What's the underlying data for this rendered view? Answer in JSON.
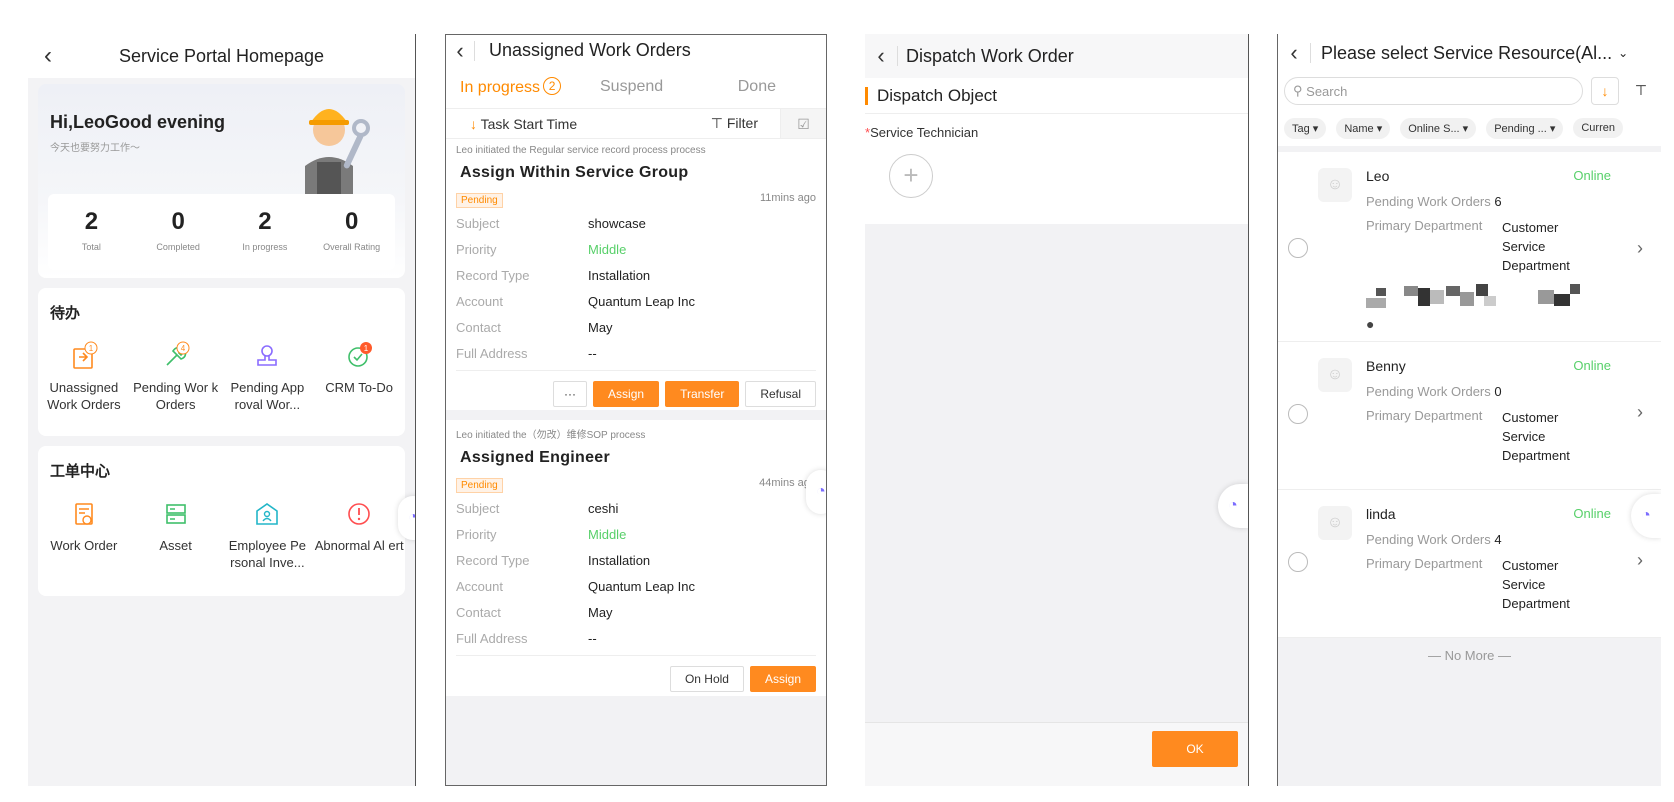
{
  "screen1": {
    "title": "Service Portal Homepage",
    "greeting": "Hi,LeoGood evening",
    "subtitle": "今天也要努力工作～",
    "stats": [
      {
        "value": "2",
        "label": "Total"
      },
      {
        "value": "0",
        "label": "Completed"
      },
      {
        "value": "2",
        "label": "In progress"
      },
      {
        "value": "0",
        "label": "Overall Rating"
      }
    ],
    "todo": {
      "title": "待办",
      "items": [
        {
          "label": "Unassigned Work Orders",
          "badge": "1",
          "icon": "work-order-clipboard-icon"
        },
        {
          "label": "Pending Wor k Orders",
          "badge": "4",
          "icon": "wrench-icon"
        },
        {
          "label": "Pending App roval Wor...",
          "badge": "",
          "icon": "approval-stamp-icon"
        },
        {
          "label": "CRM To-Do",
          "badge": "1",
          "icon": "check-circle-icon"
        }
      ]
    },
    "center": {
      "title": "工单中心",
      "items": [
        {
          "label": "Work Order",
          "icon": "work-order-icon"
        },
        {
          "label": "Asset",
          "icon": "server-icon"
        },
        {
          "label": "Employee Pe rsonal Inve...",
          "icon": "warehouse-icon"
        },
        {
          "label": "Abnormal Al ert",
          "icon": "alert-icon"
        }
      ]
    }
  },
  "screen2": {
    "title": "Unassigned Work Orders",
    "tabs": [
      {
        "label": "In progress",
        "badge": "2"
      },
      {
        "label": "Suspend"
      },
      {
        "label": "Done"
      }
    ],
    "sort_label": "Task Start Time",
    "filter_label": "Filter",
    "cards": [
      {
        "meta": "Leo initiated the Regular service record process process",
        "title": "Assign Within Service Group",
        "status": "Pending",
        "ago": "11mins ago",
        "fields": [
          {
            "k": "Subject",
            "v": "showcase"
          },
          {
            "k": "Priority",
            "v": "Middle"
          },
          {
            "k": "Record Type",
            "v": "Installation"
          },
          {
            "k": "Account",
            "v": "Quantum Leap Inc"
          },
          {
            "k": "Contact",
            "v": "May"
          },
          {
            "k": "Full Address",
            "v": "--"
          }
        ],
        "actions": [
          "···",
          "Assign",
          "Transfer",
          "Refusal"
        ]
      },
      {
        "meta": "Leo initiated the（勿改）维修SOP process",
        "title": "Assigned Engineer",
        "status": "Pending",
        "ago": "44mins ago",
        "fields": [
          {
            "k": "Subject",
            "v": "ceshi"
          },
          {
            "k": "Priority",
            "v": "Middle"
          },
          {
            "k": "Record Type",
            "v": "Installation"
          },
          {
            "k": "Account",
            "v": "Quantum Leap Inc"
          },
          {
            "k": "Contact",
            "v": "May"
          },
          {
            "k": "Full Address",
            "v": "--"
          }
        ],
        "actions": [
          "On Hold",
          "Assign"
        ]
      }
    ]
  },
  "screen3": {
    "title": "Dispatch Work Order",
    "section": "Dispatch Object",
    "field_required": "*",
    "field_label": "Service Technician",
    "ok": "OK"
  },
  "screen4": {
    "title": "Please select Service Resource(Al...",
    "search_placeholder": "Search",
    "chips": [
      "Tag ▾",
      "Name ▾",
      "Online S... ▾",
      "Pending ... ▾",
      "Curren"
    ],
    "resources": [
      {
        "name": "Leo",
        "status": "Online",
        "pending_label": "Pending Work Orders",
        "pending": "6",
        "dept_label": "Primary Department",
        "dept": "Customer Service Department"
      },
      {
        "name": "Benny",
        "status": "Online",
        "pending_label": "Pending Work Orders",
        "pending": "0",
        "dept_label": "Primary Department",
        "dept": "Customer Service Department"
      },
      {
        "name": "linda",
        "status": "Online",
        "pending_label": "Pending Work Orders",
        "pending": "4",
        "dept_label": "Primary Department",
        "dept": "Customer Service Department"
      }
    ],
    "no_more": "No More"
  },
  "colors": {
    "accent": "#ff8a1f",
    "online": "#58d06a",
    "background": "#f2f2f4"
  }
}
